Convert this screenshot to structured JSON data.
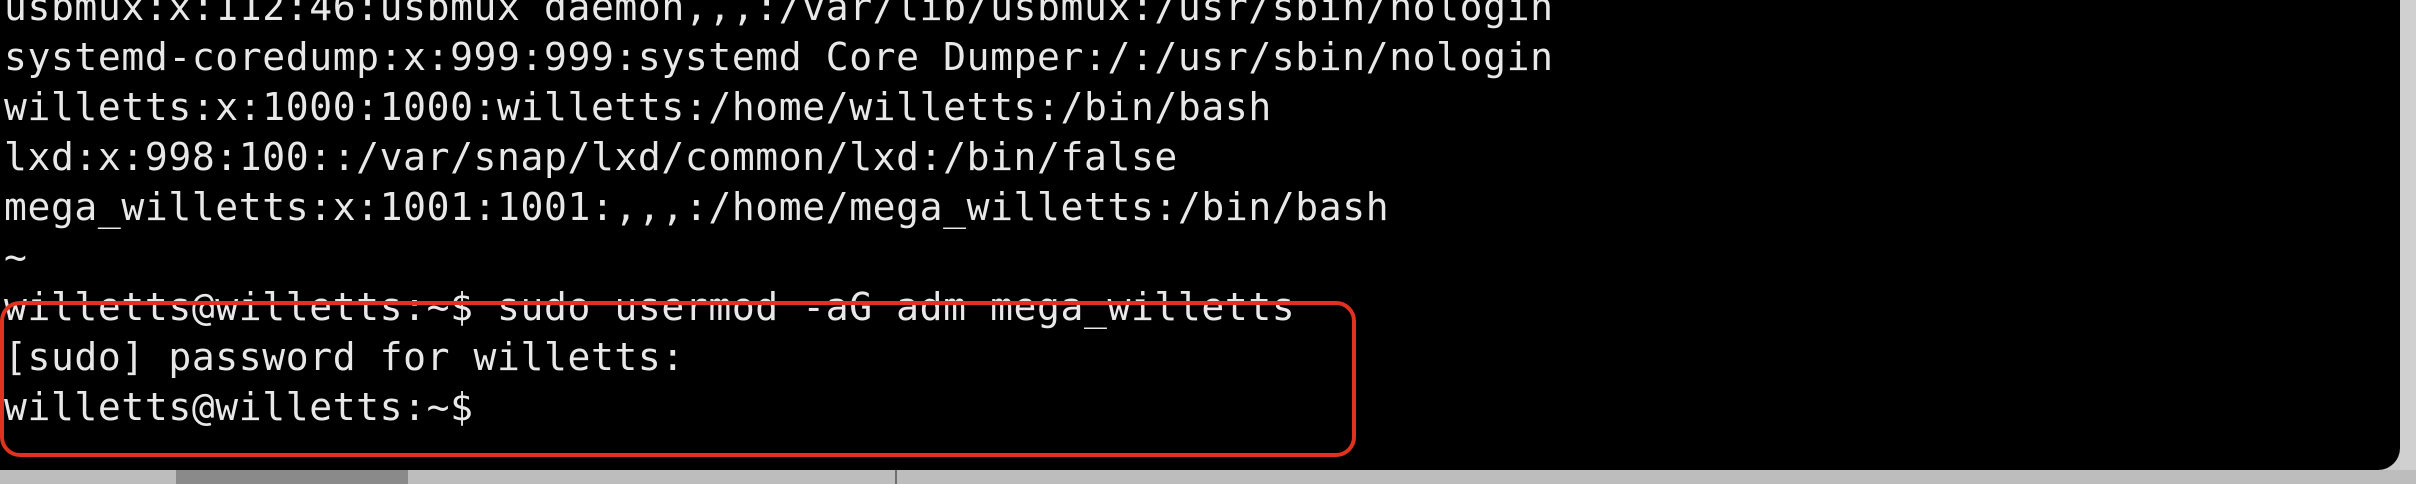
{
  "terminal": {
    "lines": [
      "usbmux:x:112:46:usbmux daemon,,,:/var/lib/usbmux:/usr/sbin/nologin",
      "systemd-coredump:x:999:999:systemd Core Dumper:/:/usr/sbin/nologin",
      "willetts:x:1000:1000:willetts:/home/willetts:/bin/bash",
      "lxd:x:998:100::/var/snap/lxd/common/lxd:/bin/false",
      "mega_willetts:x:1001:1001:,,,:/home/mega_willetts:/bin/bash",
      "~",
      "willetts@willetts:~$ sudo usermod -aG adm mega_willetts",
      "[sudo] password for willetts:",
      "willetts@willetts:~$"
    ]
  }
}
